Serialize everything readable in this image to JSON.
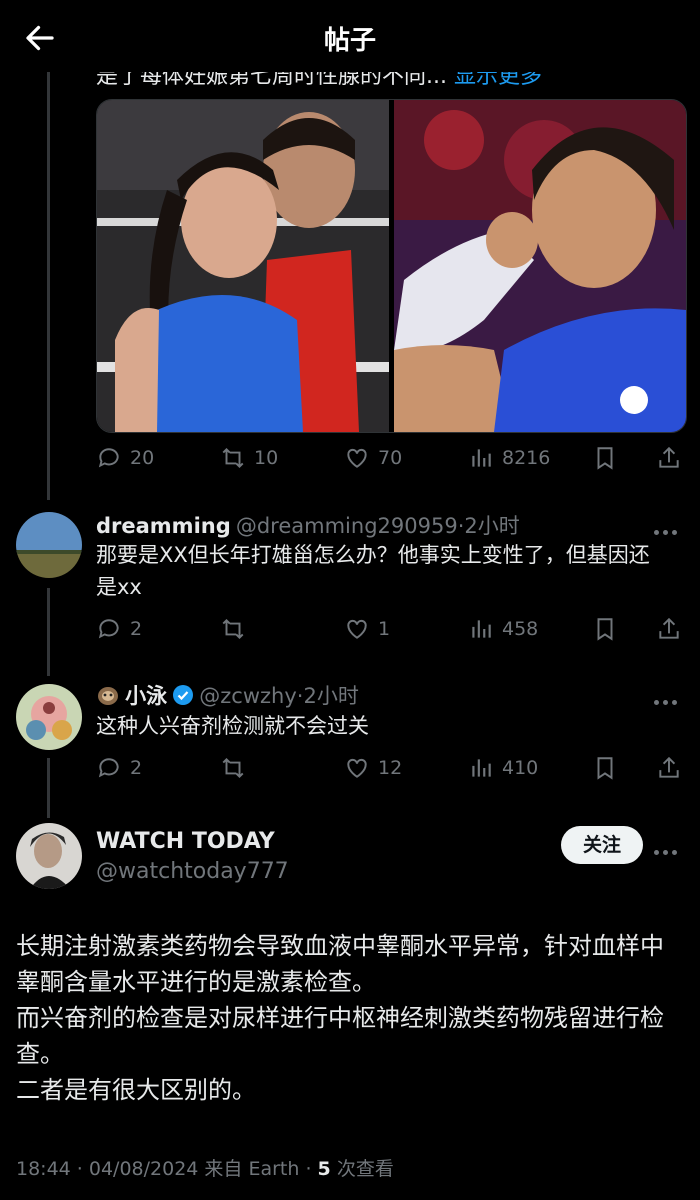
{
  "header": {
    "title": "帖子"
  },
  "prev_post": {
    "cut_text": "是了每体妊娠第七周时性腺的不同...",
    "show_more": "显示更多",
    "stats": {
      "replies": "20",
      "reposts": "10",
      "likes": "70",
      "views": "8216"
    }
  },
  "replies": [
    {
      "name": "dreamming",
      "handle": "@dreamming290959",
      "time": "·2小时",
      "text": "那要是XX但长年打雄甾怎么办？他事实上变性了，但基因还是xx",
      "stats": {
        "replies": "2",
        "reposts": "",
        "likes": "1",
        "views": "458"
      }
    },
    {
      "name": "小泳",
      "handle": "@zcwzhy",
      "time": "·2小时",
      "text": "这种人兴奋剂检测就不会过关",
      "stats": {
        "replies": "2",
        "reposts": "",
        "likes": "12",
        "views": "410"
      }
    }
  ],
  "main_post": {
    "name": "WATCH TODAY",
    "handle": "@watchtoday777",
    "follow_label": "关注",
    "lines": [
      "长期注射激素类药物会导致血液中睾酮水平异常，针对血样中睾酮含量水平进行的是激素检查。",
      "而兴奋剂的检查是对尿样进行中枢神经刺激类药物残留进行检查。",
      "二者是有很大区别的。"
    ],
    "meta_prefix": "18:44 · 04/08/2024 来自 Earth · ",
    "views_count": "5",
    "views_suffix": " 次查看"
  },
  "colors": {
    "accent": "#1d9bf0",
    "muted": "#71767b",
    "verified": "#1d9bf0"
  }
}
